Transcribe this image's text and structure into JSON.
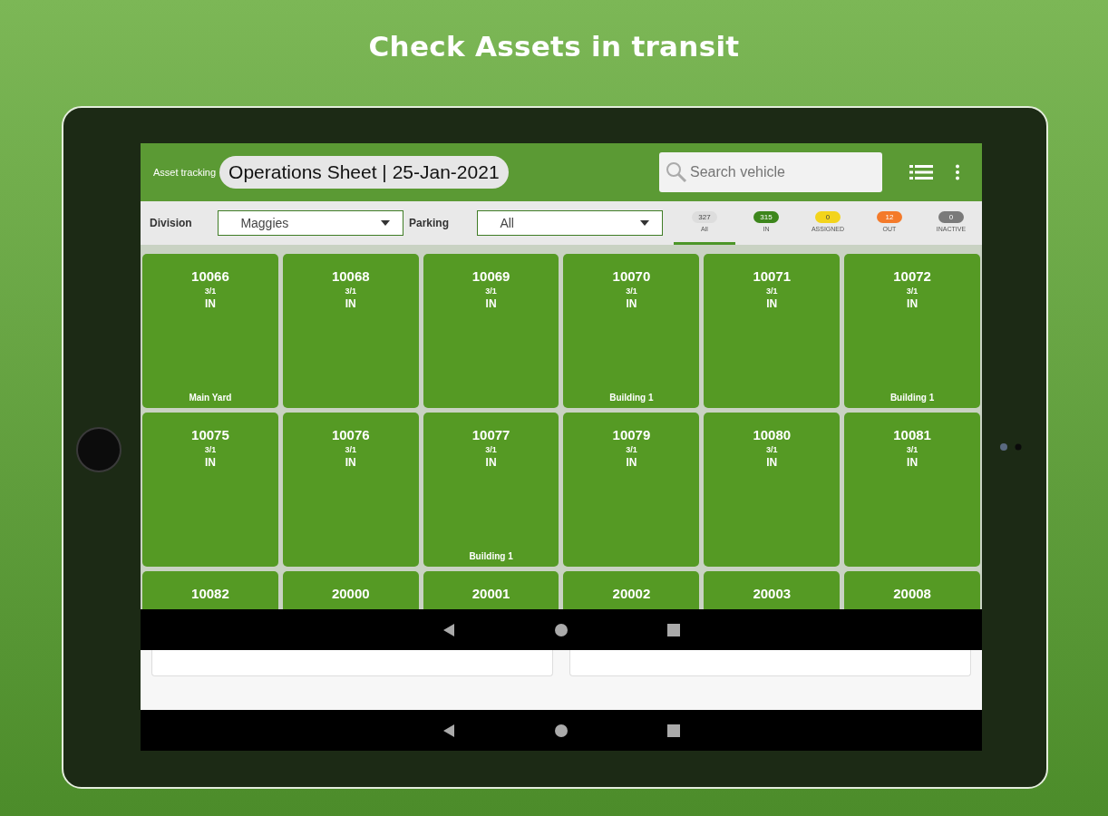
{
  "promo": {
    "heading": "Check Assets in transit"
  },
  "header": {
    "app_name": "Asset tracking",
    "title": "Operations Sheet | 25-Jan-2021",
    "search": {
      "placeholder": "Search vehicle"
    }
  },
  "filters": [
    {
      "label": "Division",
      "value": "Maggies"
    },
    {
      "label": "Parking",
      "value": "All"
    }
  ],
  "status_tabs": [
    {
      "count": "327",
      "label": "All",
      "selected": true,
      "color": "#dddddd"
    },
    {
      "count": "315",
      "label": "IN",
      "selected": false,
      "color": "#3d861c"
    },
    {
      "count": "0",
      "label": "ASSIGNED",
      "selected": false,
      "color": "#f3d41c"
    },
    {
      "count": "12",
      "label": "OUT",
      "selected": false,
      "color": "#f47a2a"
    },
    {
      "count": "0",
      "label": "INACTIVE",
      "selected": false,
      "color": "#7a7a7a"
    }
  ],
  "assets": [
    {
      "number": "10066",
      "ratio": "3/1",
      "status": "IN",
      "location": "Main Yard"
    },
    {
      "number": "10068",
      "ratio": "3/1",
      "status": "IN"
    },
    {
      "number": "10069",
      "ratio": "3/1",
      "status": "IN"
    },
    {
      "number": "10070",
      "ratio": "3/1",
      "status": "IN",
      "location": "Building 1"
    },
    {
      "number": "10071",
      "ratio": "3/1",
      "status": "IN"
    },
    {
      "number": "10072",
      "ratio": "3/1",
      "status": "IN",
      "location": "Building 1"
    },
    {
      "number": "10075",
      "ratio": "3/1",
      "status": "IN"
    },
    {
      "number": "10076",
      "ratio": "3/1",
      "status": "IN"
    },
    {
      "number": "10077",
      "ratio": "3/1",
      "status": "IN",
      "location": "Building 1"
    },
    {
      "number": "10079",
      "ratio": "3/1",
      "status": "IN"
    },
    {
      "number": "10080",
      "ratio": "3/1",
      "status": "IN"
    },
    {
      "number": "10081",
      "ratio": "3/1",
      "status": "IN"
    },
    {
      "number": "10082"
    },
    {
      "number": "20000"
    },
    {
      "number": "20001"
    },
    {
      "number": "20002"
    },
    {
      "number": "20003"
    },
    {
      "number": "20008"
    }
  ]
}
